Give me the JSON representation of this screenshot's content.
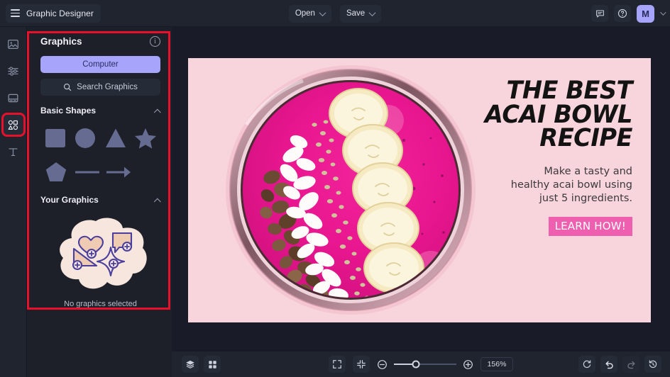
{
  "app": {
    "title": "Graphic Designer",
    "accent_purple": "#a6a4fb",
    "highlight_red": "#e8112b",
    "panel_bg": "#1d2029",
    "canvas_bg": "#f8d4dc"
  },
  "topbar": {
    "menu_icon": "hamburger-icon",
    "open_label": "Open",
    "save_label": "Save",
    "comment_icon": "comment-icon",
    "help_icon": "help-icon",
    "avatar_initial": "M",
    "account_chevron": "chevron-down-icon"
  },
  "rail": {
    "items": [
      {
        "name": "image-tool",
        "icon": "image-icon",
        "active": false
      },
      {
        "name": "adjustments-tool",
        "icon": "sliders-icon",
        "active": false
      },
      {
        "name": "layout-tool",
        "icon": "layout-icon",
        "active": false
      },
      {
        "name": "graphics-tool",
        "icon": "shapes-icon",
        "active": true
      },
      {
        "name": "text-tool",
        "icon": "text-icon",
        "active": false
      }
    ]
  },
  "panel": {
    "title": "Graphics",
    "info_icon": "info-icon",
    "source_button": "Computer",
    "search_placeholder": "Search Graphics",
    "search_icon": "search-icon",
    "sections": [
      {
        "title": "Basic Shapes",
        "collapse_icon": "chevron-up-icon",
        "shapes": [
          "square-shape",
          "circle-shape",
          "triangle-shape",
          "star-shape",
          "pentagon-shape",
          "line-shape",
          "arrow-shape"
        ]
      },
      {
        "title": "Your Graphics",
        "collapse_icon": "chevron-up-icon",
        "empty_label": "No graphics selected"
      }
    ]
  },
  "canvas": {
    "headline_line1": "THE BEST",
    "headline_line2": "ACAI BOWL",
    "headline_line3": "RECIPE",
    "subcopy_line1": "Make a tasty and",
    "subcopy_line2": "healthy acai bowl using",
    "subcopy_line3": "just 5 ingredients.",
    "cta_label": "LEARN HOW!",
    "cta_color": "#ee5fb0",
    "background_color": "#f8d4dc",
    "photo_alt": "acai-smoothie-bowl-photo"
  },
  "bottombar": {
    "layers_icon": "layers-icon",
    "grid_icon": "grid-icon",
    "fullscreen_icon": "fullscreen-icon",
    "fit_icon": "fit-to-screen-icon",
    "zoom_out_icon": "zoom-out-icon",
    "zoom_in_icon": "zoom-in-icon",
    "zoom_level": "156%",
    "reset_icon": "reset-icon",
    "undo_icon": "undo-icon",
    "redo_icon": "redo-icon",
    "history_icon": "history-icon"
  }
}
